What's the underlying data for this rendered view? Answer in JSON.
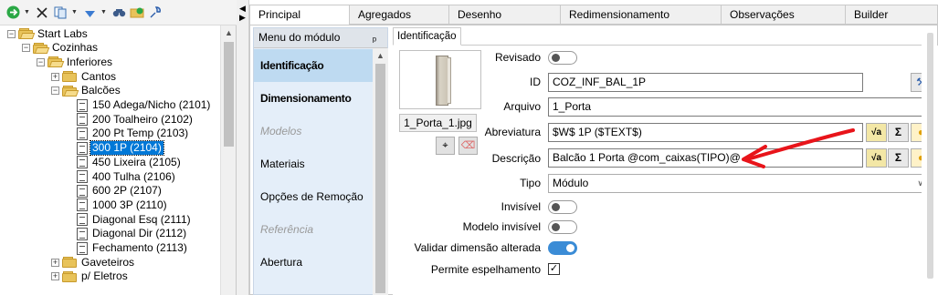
{
  "tree": {
    "toolbar": {
      "icons": [
        "refresh-icon",
        "delete-icon",
        "copy-icon",
        "move-icon",
        "search-icon",
        "folder-sync-icon",
        "model-tool-icon"
      ]
    },
    "nodes": [
      {
        "label": "Start Labs",
        "indent": 0,
        "expander": "−",
        "icon": "folder-open"
      },
      {
        "label": "Cozinhas",
        "indent": 1,
        "expander": "−",
        "icon": "folder-open"
      },
      {
        "label": "Inferiores",
        "indent": 2,
        "expander": "−",
        "icon": "folder-open"
      },
      {
        "label": "Cantos",
        "indent": 3,
        "expander": "+",
        "icon": "folder"
      },
      {
        "label": "Balcões",
        "indent": 3,
        "expander": "−",
        "icon": "folder-open"
      },
      {
        "label": "150 Adega/Nicho (2101)",
        "indent": 4,
        "icon": "doc"
      },
      {
        "label": "200 Toalheiro (2102)",
        "indent": 4,
        "icon": "doc"
      },
      {
        "label": "200 Pt Temp (2103)",
        "indent": 4,
        "icon": "doc"
      },
      {
        "label": "300 1P (2104)",
        "indent": 4,
        "icon": "doc",
        "selected": true
      },
      {
        "label": "450 Lixeira (2105)",
        "indent": 4,
        "icon": "doc"
      },
      {
        "label": "400 Tulha (2106)",
        "indent": 4,
        "icon": "doc"
      },
      {
        "label": "600 2P (2107)",
        "indent": 4,
        "icon": "doc"
      },
      {
        "label": "1000 3P (2110)",
        "indent": 4,
        "icon": "doc"
      },
      {
        "label": "Diagonal Esq (2111)",
        "indent": 4,
        "icon": "doc"
      },
      {
        "label": "Diagonal Dir (2112)",
        "indent": 4,
        "icon": "doc"
      },
      {
        "label": "Fechamento (2113)",
        "indent": 4,
        "icon": "doc"
      },
      {
        "label": "Gaveteiros",
        "indent": 3,
        "expander": "+",
        "icon": "folder"
      },
      {
        "label": "p/ Eletros",
        "indent": 3,
        "expander": "+",
        "icon": "folder"
      }
    ]
  },
  "tabs": [
    "Principal",
    "Agregados",
    "Desenho",
    "Redimensionamento",
    "Observações",
    "Builder"
  ],
  "active_tab": "Principal",
  "menu": {
    "header": "Menu do módulo",
    "items": [
      {
        "label": "Identificação",
        "style": "bold",
        "active": true
      },
      {
        "label": "Dimensionamento",
        "style": "bold"
      },
      {
        "label": "Modelos",
        "style": "disabled"
      },
      {
        "label": "Materiais",
        "style": "normal"
      },
      {
        "label": "Opções de Remoção",
        "style": "normal"
      },
      {
        "label": "Referência",
        "style": "disabled"
      },
      {
        "label": "Abertura",
        "style": "normal"
      }
    ]
  },
  "inner_tab": "Identificação",
  "image_file": "1_Porta_1.jpg",
  "form": {
    "revisado_label": "Revisado",
    "revisado_on": false,
    "id_label": "ID",
    "id_value": "COZ_INF_BAL_1P",
    "arquivo_label": "Arquivo",
    "arquivo_value": "1_Porta",
    "abreviatura_label": "Abreviatura",
    "abreviatura_value": "$W$ 1P ($TEXT$)",
    "descricao_label": "Descrição",
    "descricao_value": "Balcão 1 Porta @com_caixas(TIPO)@",
    "tipo_label": "Tipo",
    "tipo_value": "Módulo",
    "invisivel_label": "Invisível",
    "invisivel_on": false,
    "modelo_invisivel_label": "Modelo invisível",
    "modelo_invisivel_on": false,
    "validar_label": "Validar dimensão alterada",
    "validar_on": true,
    "espelhamento_label": "Permite espelhamento",
    "espelhamento_checked": true
  },
  "buttons": {
    "sigma": "Σ",
    "formula": "√a"
  },
  "colors": {
    "accent": "#0078d7",
    "arrow": "#e8141a",
    "menu_active": "#bedaf1",
    "toggle_on": "#3b8cd6"
  }
}
